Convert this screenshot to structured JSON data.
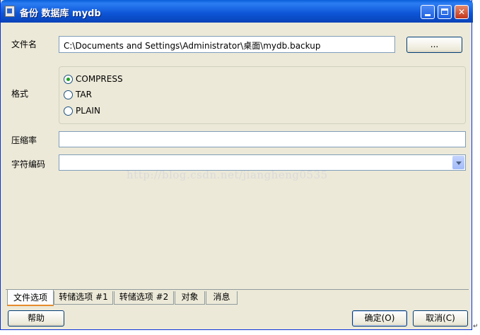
{
  "window": {
    "title": "备份 数据库 mydb"
  },
  "form": {
    "filename_label": "文件名",
    "filename_value": "C:\\Documents and Settings\\Administrator\\桌面\\mydb.backup",
    "browse_label": "...",
    "format_label": "格式",
    "format_options": [
      {
        "label": "COMPRESS",
        "selected": true
      },
      {
        "label": "TAR",
        "selected": false
      },
      {
        "label": "PLAIN",
        "selected": false
      }
    ],
    "compression_label": "压缩率",
    "compression_value": "",
    "encoding_label": "字符编码",
    "encoding_value": ""
  },
  "watermark": "http://blog.csdn.net/jiangheng0535",
  "tabs": [
    {
      "label": "文件选项",
      "active": true
    },
    {
      "label": "转储选项 #1",
      "active": false
    },
    {
      "label": "转储选项 #2",
      "active": false
    },
    {
      "label": "对象",
      "active": false
    },
    {
      "label": "消息",
      "active": false
    }
  ],
  "footer": {
    "help_label": "帮助",
    "ok_label": "确定(O)",
    "cancel_label": "取消(C)"
  },
  "colors": {
    "titlebar": "#0d55d6",
    "window_bg": "#ece9d8",
    "radio_checked": "#21a121",
    "active_tab_accent": "#e68b2c"
  }
}
